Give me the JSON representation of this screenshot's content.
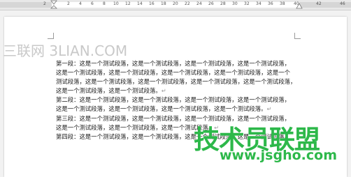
{
  "ruler": {
    "numbers": [
      "2",
      "2",
      "4",
      "6",
      "8",
      "10",
      "12",
      "14",
      "16",
      "18",
      "20",
      "22",
      "24",
      "26",
      "28",
      "30",
      "32",
      "34",
      "36",
      "38",
      "40",
      "42",
      "46"
    ]
  },
  "watermark": {
    "left_text": "三联网 3LIAN.COM",
    "right_cn": "技术员联盟",
    "right_url": "www.jsgho.com"
  },
  "document": {
    "lines": [
      "第一段：这是一个测试段落，这是一个测试段落，这是一个测试段落，这是一个测试段落，",
      "这是一个测试段落，这是一个测试段落，这是一个测试段落，这是一个测试段落，这是一个",
      "测试段落，这是一个测试段落，这是一个测试段落，这是一个测试段落，这是一个测试段落，",
      "这是一个测试段落，这是一个测试段落。",
      "第二段：这是一个测试段落，这是一个测试段落，这是一个测试段落，这是一个测试段落，",
      "这是一个测试段落，这是一个测试段落，这是一个测试段落，这是一个测试段落。",
      "第三段：这是一个测试段落，这是一个测试段落，这是一个测试段落，这是一个测试段落，",
      "这是一个测试段落，这是一个测试段落，这是一个测试段落。",
      "第四段：这是一个测试段落，这是一个测试段落，这是一个测试段落，这是一个测试段落。"
    ],
    "pilcrow": "↵"
  }
}
